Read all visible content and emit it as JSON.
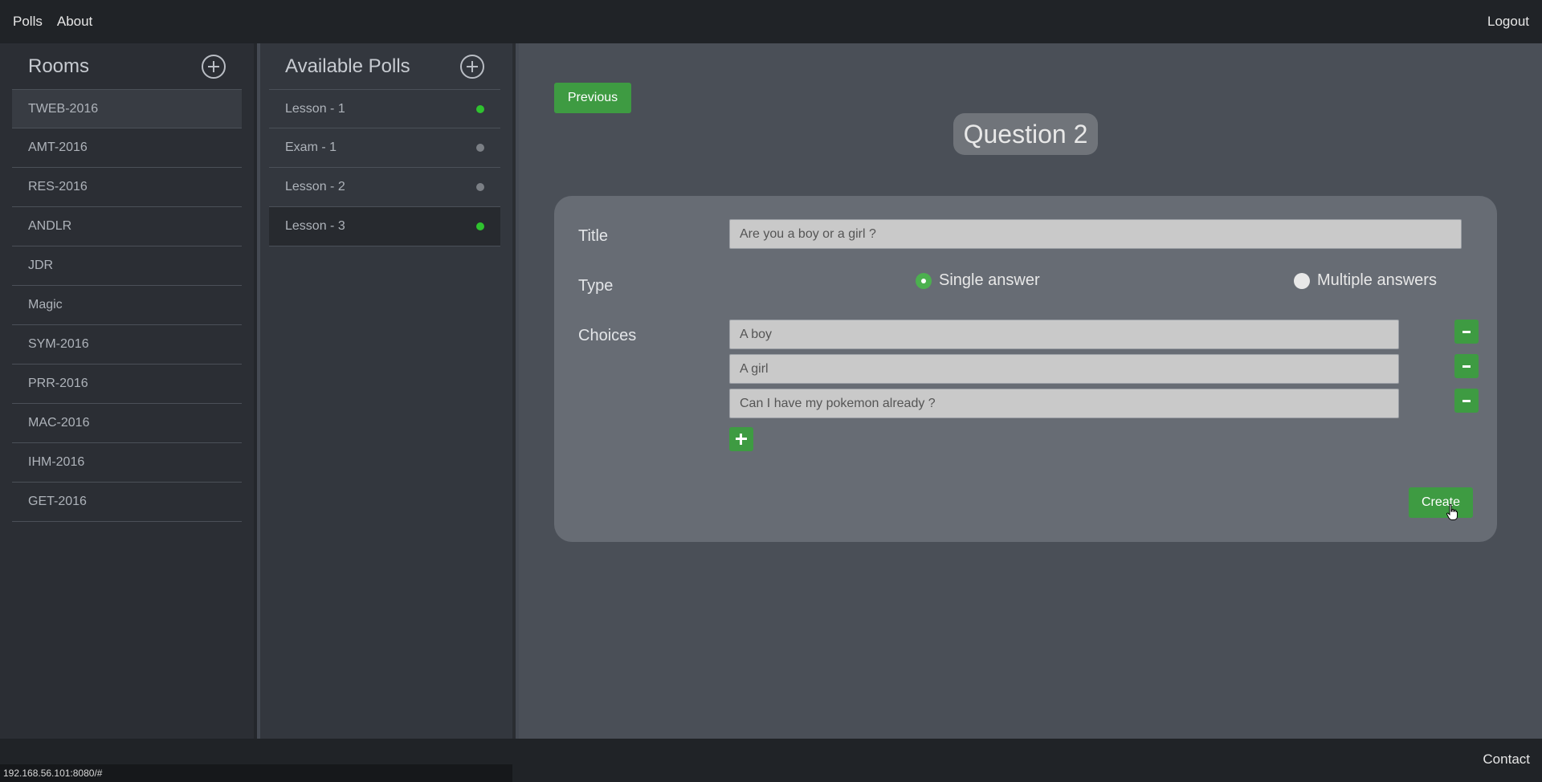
{
  "navbar": {
    "links": [
      "Polls",
      "About"
    ],
    "logout": "Logout"
  },
  "rooms": {
    "title": "Rooms",
    "items": [
      "TWEB-2016",
      "AMT-2016",
      "RES-2016",
      "ANDLR",
      "JDR",
      "Magic",
      "SYM-2016",
      "PRR-2016",
      "MAC-2016",
      "IHM-2016",
      "GET-2016"
    ],
    "active_index": 0
  },
  "polls": {
    "title": "Available Polls",
    "items": [
      {
        "label": "Lesson - 1",
        "status": "active"
      },
      {
        "label": "Exam - 1",
        "status": "inactive"
      },
      {
        "label": "Lesson - 2",
        "status": "inactive"
      },
      {
        "label": "Lesson - 3",
        "status": "active"
      }
    ],
    "selected_index": 3
  },
  "main": {
    "previous_label": "Previous",
    "question_label": "Question 2",
    "form": {
      "title_label": "Title",
      "title_value": "Are you a boy or a girl ?",
      "type_label": "Type",
      "type_options": [
        "Single answer",
        "Multiple answers"
      ],
      "type_selected": 0,
      "choices_label": "Choices",
      "choices": [
        "A boy",
        "A girl",
        "Can I have my pokemon already ?"
      ],
      "create_label": "Create"
    }
  },
  "footer": {
    "status_url": "192.168.56.101:8080/#",
    "contact": "Contact"
  },
  "colors": {
    "accent_green": "#3e9b42",
    "active_dot": "#2fc22f",
    "inactive_dot": "#7b7f85",
    "navbar_bg": "#202327"
  }
}
